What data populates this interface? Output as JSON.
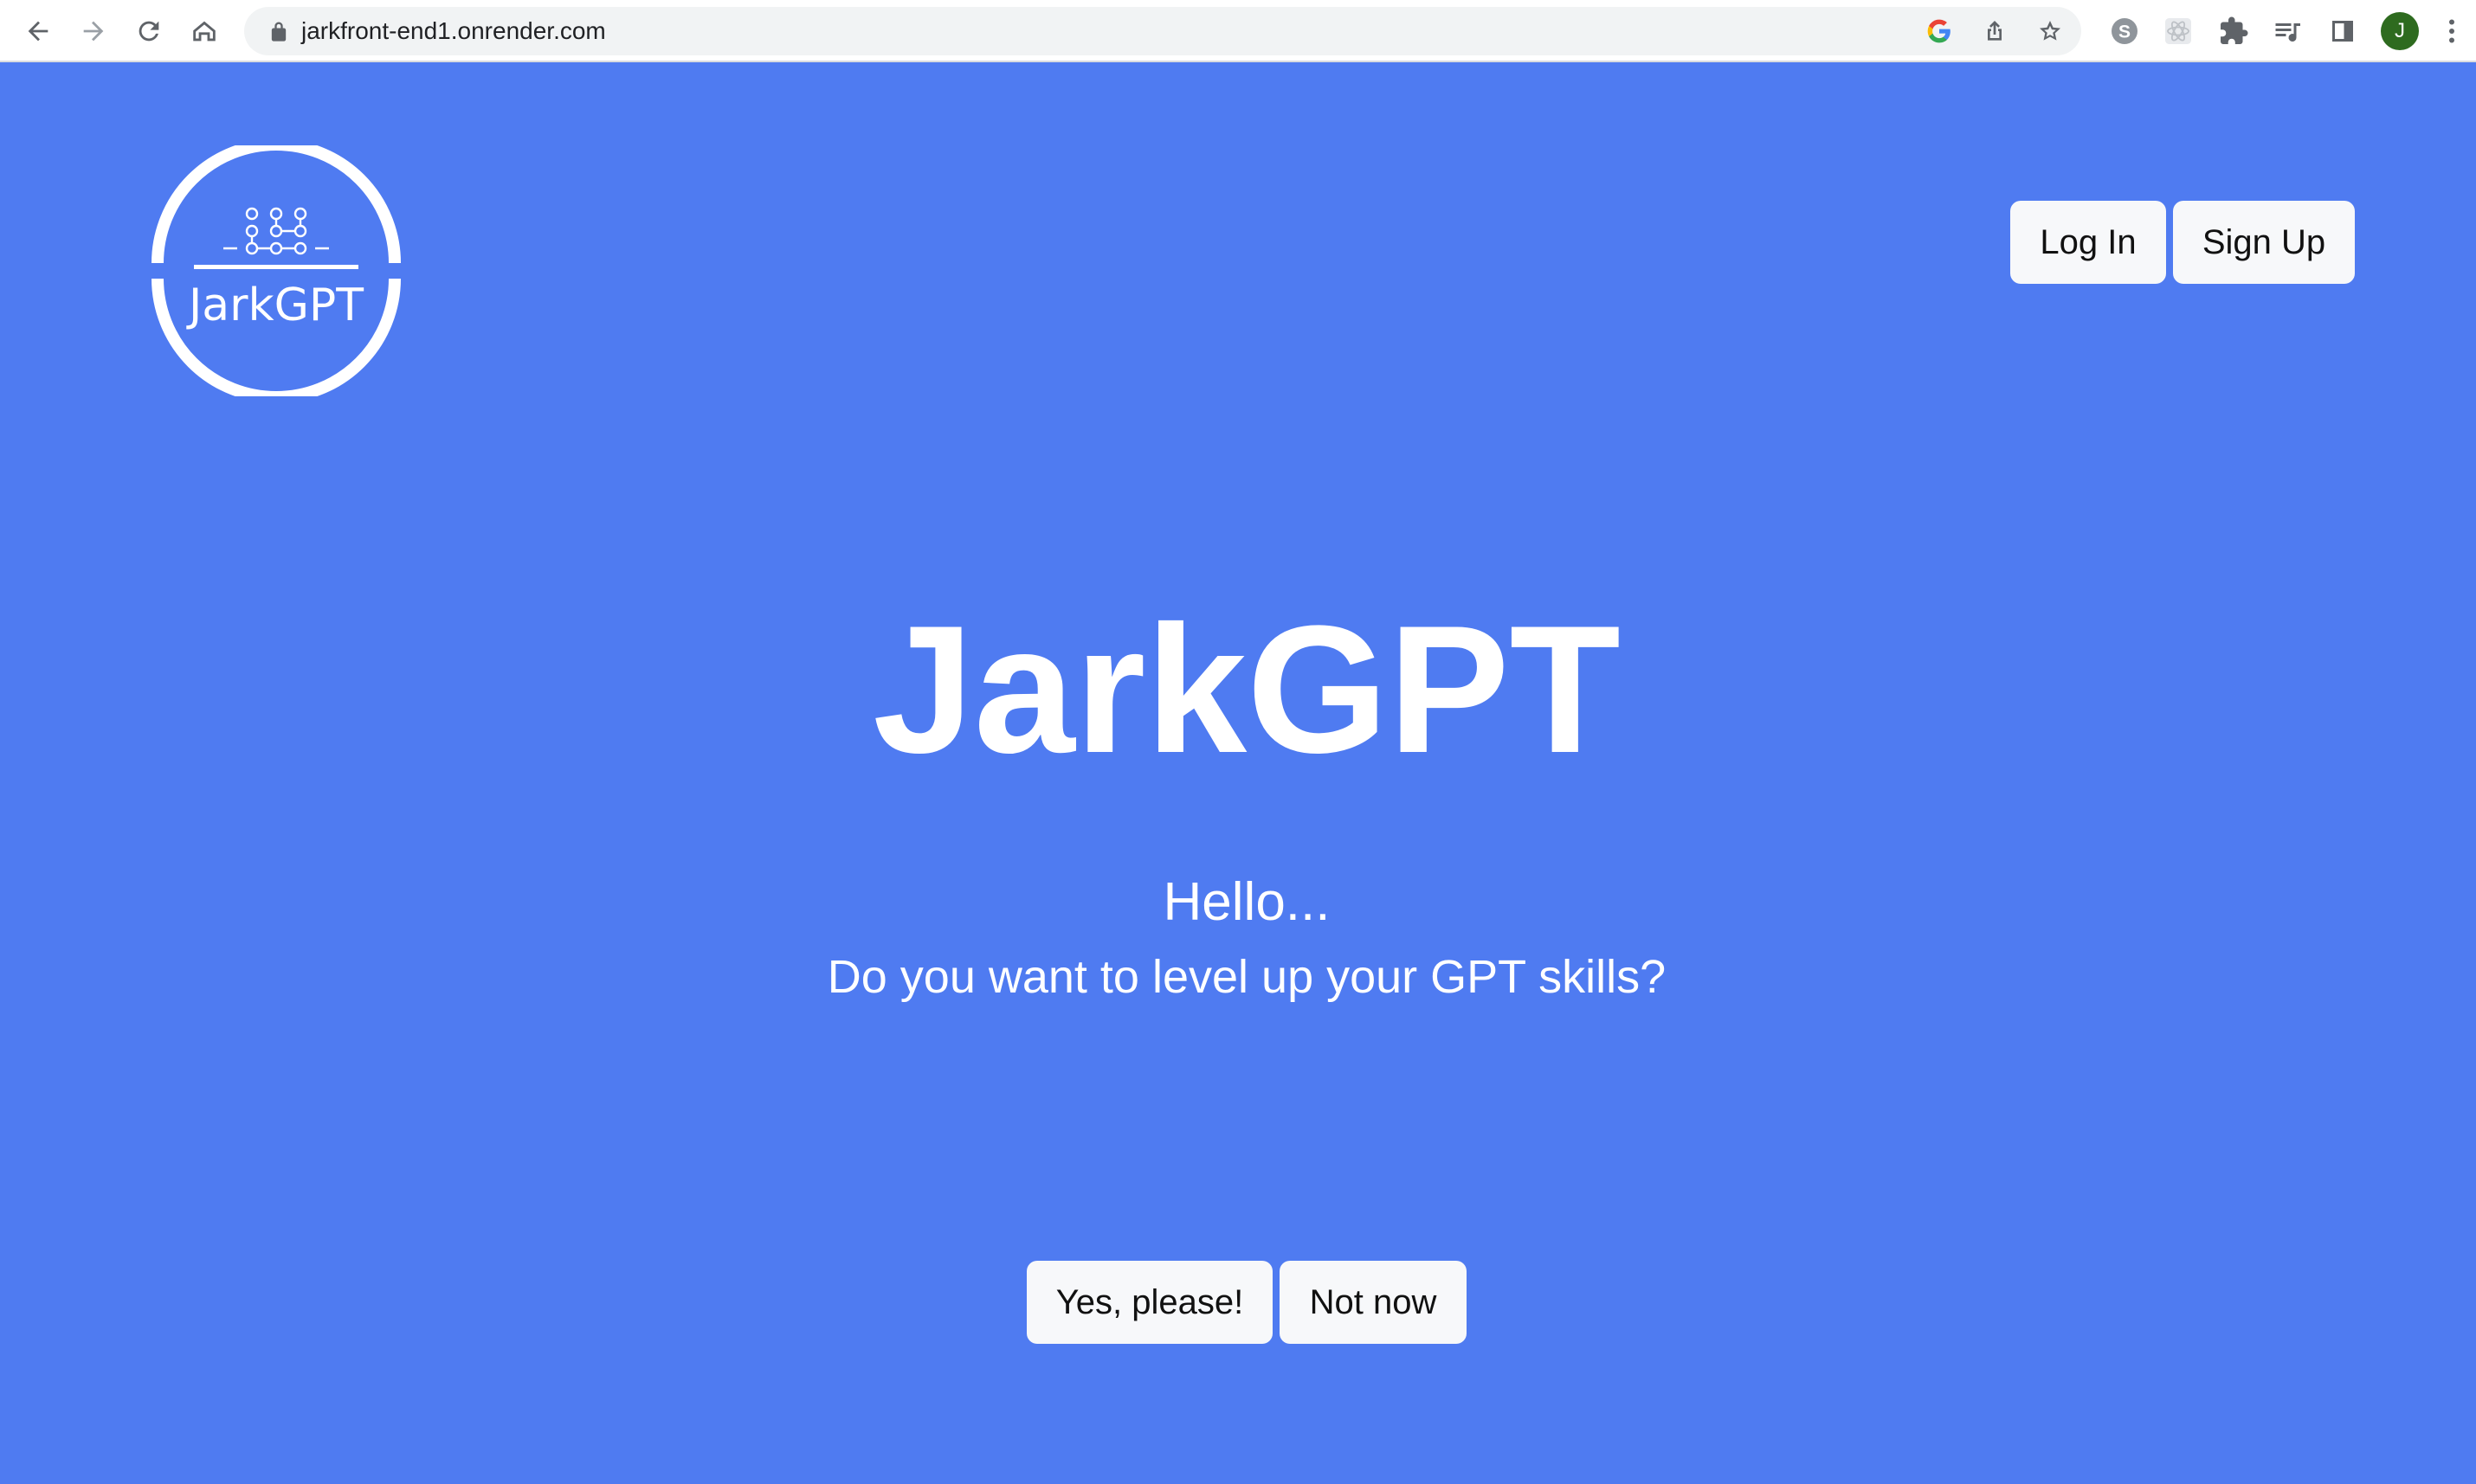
{
  "browser": {
    "url": "jarkfront-end1.onrender.com",
    "profile_initial": "J",
    "icons": [
      "back-icon",
      "forward-icon",
      "reload-icon",
      "home-icon",
      "lock-icon",
      "google-icon",
      "share-icon",
      "bookmark-star-icon",
      "skype-extension-icon",
      "react-extension-icon",
      "puzzle-extensions-icon",
      "media-queue-icon",
      "side-panel-icon",
      "menu-kebab-icon"
    ]
  },
  "header": {
    "logo_text": "JarkGPT",
    "login_label": "Log In",
    "signup_label": "Sign Up"
  },
  "hero": {
    "title": "JarkGPT",
    "greeting": "Hello...",
    "question": "Do you want to level up your GPT skills?",
    "yes_label": "Yes, please!",
    "no_label": "Not now"
  },
  "colors": {
    "page_background": "#4f7bf1",
    "button_background": "#f7f8fa",
    "text_on_page": "#ffffff",
    "avatar": "#2e6b1f"
  }
}
